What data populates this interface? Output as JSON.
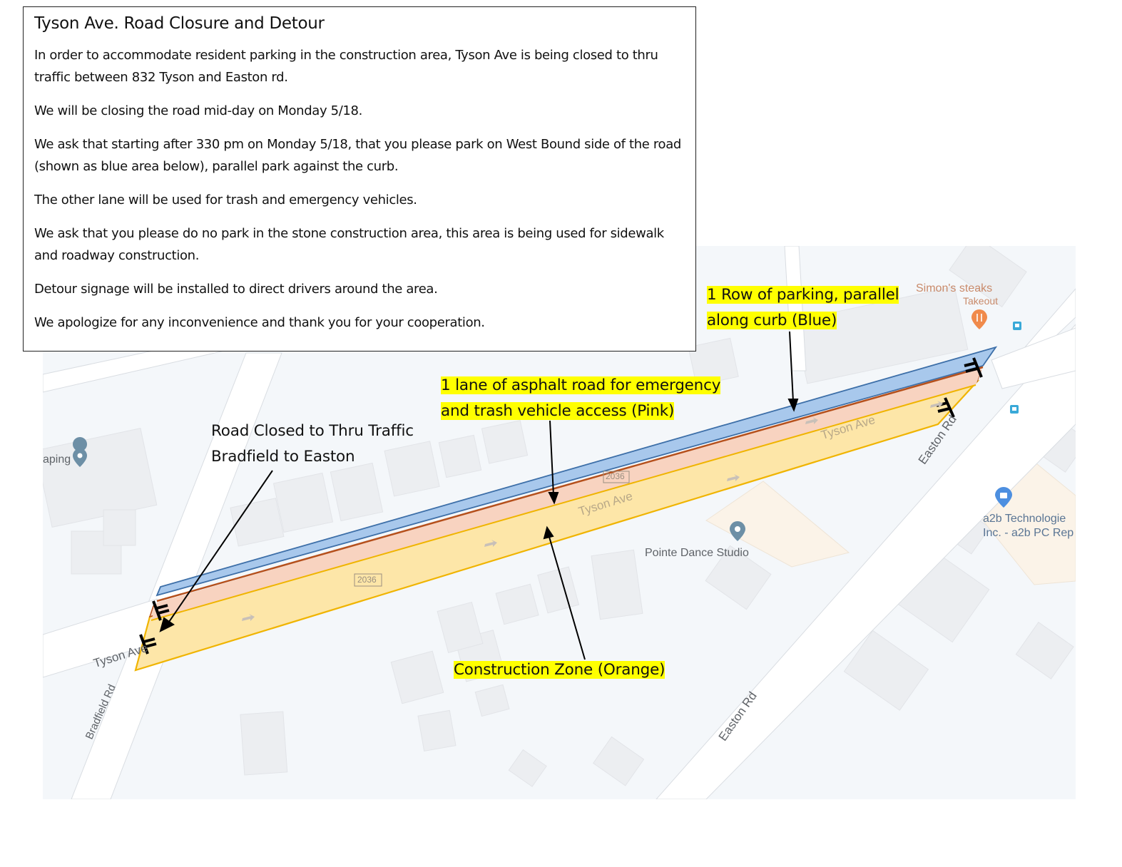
{
  "notice": {
    "title": "Tyson Ave. Road Closure and Detour",
    "paragraphs": [
      "In order to accommodate resident parking in the construction area, Tyson Ave is being closed to thru traffic between 832 Tyson and Easton rd.",
      "We will be closing the road mid-day on Monday 5/18.",
      "We ask that starting after 330 pm on Monday 5/18, that you please park on West Bound side of the road (shown as blue area below), parallel park against the curb.",
      "The other lane will be used for trash and emergency vehicles.",
      "We ask that you please do no park in the stone construction area, this area is being used for sidewalk and roadway construction.",
      "Detour signage will be installed to direct drivers around the area.",
      "We apologize for any inconvenience and thank you for your cooperation."
    ]
  },
  "callouts": {
    "parking": {
      "line1": "1 Row of parking, parallel",
      "line2": "along curb (Blue)"
    },
    "emergency_lane": {
      "line1": "1 lane of asphalt road for emergency",
      "line2": "and trash vehicle access (Pink)"
    },
    "road_closed": {
      "line1": "Road Closed to Thru Traffic",
      "line2": "Bradfield to Easton"
    },
    "construction": {
      "line1": "Construction Zone (Orange)"
    }
  },
  "map": {
    "street_labels": {
      "tyson_ave_main": "Tyson Ave",
      "tyson_ave_east": "Tyson Ave",
      "tyson_ave_west": "Tyson Ave",
      "easton_rd_north": "Easton Rd",
      "easton_rd_south": "Easton Rd",
      "bradfield_rd": "Bradfield Rd"
    },
    "route_shields": [
      "2036",
      "2036"
    ],
    "places": {
      "simons_name": "Simon's steaks",
      "simons_sub": "Takeout",
      "pointe": "Pointe Dance Studio",
      "a2b_line1": "a2b Technologie",
      "a2b_line2": "Inc. - a2b PC Rep",
      "landscaping_partial": "aping"
    },
    "zones": {
      "parking_color": "#a8c8ec",
      "parking_stroke": "#3d6fa8",
      "lane_color": "#f8d3c0",
      "lane_stroke": "#b5501c",
      "construction_color": "#fde6a8",
      "construction_stroke": "#f0b400"
    },
    "highlight_color": "#ffff00"
  }
}
